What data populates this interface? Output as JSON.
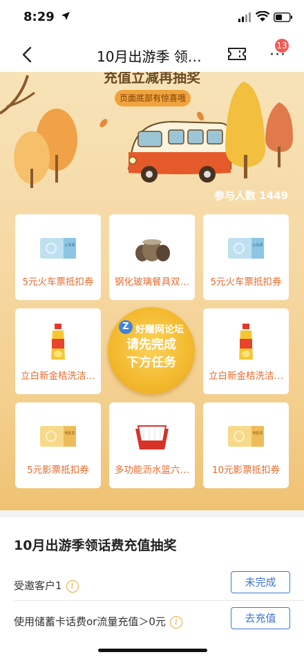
{
  "status_bar": {
    "time": "8:29"
  },
  "navbar": {
    "title": "10月出游季 领…",
    "badge_count": "13"
  },
  "banner": {
    "title": "充值立减再抽奖",
    "pill_text": "页面底部有惊喜哦",
    "participants": "参与人数 1449"
  },
  "prizes": [
    {
      "label": "5元火车票抵扣券",
      "icon": "train-ticket-icon",
      "stub_text": "火车票"
    },
    {
      "label": "钢化玻璃餐具双…",
      "icon": "glass-bowls-icon"
    },
    {
      "label": "5元火车票抵扣券",
      "icon": "train-ticket-icon",
      "stub_text": "火车票"
    },
    {
      "label": "立白新金桔洗洁…",
      "icon": "detergent-bottle-icon"
    },
    {
      "label": "立白新金桔洗洁…",
      "icon": "detergent-bottle-icon"
    },
    {
      "label": "5元影票抵扣券",
      "icon": "movie-ticket-icon",
      "stub_text": "电影票"
    },
    {
      "label": "多功能沥水篮六…",
      "icon": "drain-basket-icon"
    },
    {
      "label": "10元影票抵扣券",
      "icon": "movie-ticket-icon",
      "stub_text": "电影票"
    }
  ],
  "center_button": {
    "watermark": "好赚网论坛",
    "line1": "请先完成",
    "line2": "下方任务"
  },
  "tasks": {
    "title": "10月出游季领话费充值抽奖",
    "items": [
      {
        "label": "受邀客户1",
        "button": "未完成"
      },
      {
        "label": "使用储蓄卡话费or流量充值＞0元",
        "button": "去充值"
      }
    ]
  },
  "colors": {
    "accent_blue": "#3b76d4",
    "prize_orange": "#e86a2c",
    "badge_red": "#f15a55"
  }
}
